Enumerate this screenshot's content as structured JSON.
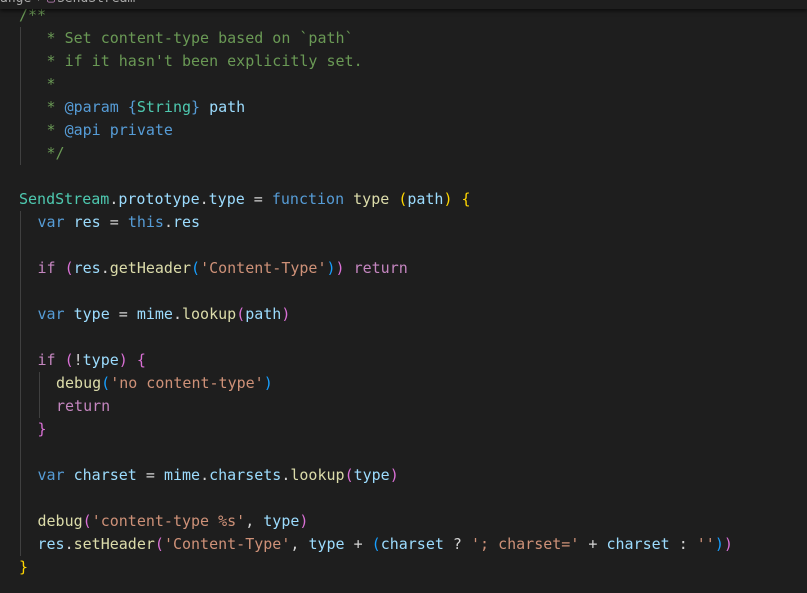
{
  "breadcrumb": {
    "segment1": "ange",
    "separator": "›",
    "symbol_icon": "method-icon",
    "segment2": "SendStream"
  },
  "colors": {
    "background": "#1e1e1e",
    "comment": "#6a9955",
    "keyword": "#569cd6",
    "control": "#c586c0",
    "variable": "#9cdcfe",
    "function": "#dcdcaa",
    "string": "#ce9178",
    "type": "#4ec9b0",
    "bracket_level1": "#ffd700",
    "bracket_level2": "#da70d6",
    "bracket_level3": "#179fff"
  },
  "code": [
    {
      "indent": 0,
      "tokens": [
        {
          "t": "/**",
          "c": "comment"
        }
      ]
    },
    {
      "indent": 1,
      "tokens": [
        {
          "t": " * Set content-type based on `path`",
          "c": "comment"
        }
      ]
    },
    {
      "indent": 1,
      "tokens": [
        {
          "t": " * if it hasn't been explicitly set.",
          "c": "comment"
        }
      ]
    },
    {
      "indent": 1,
      "tokens": [
        {
          "t": " *",
          "c": "comment"
        }
      ]
    },
    {
      "indent": 1,
      "tokens": [
        {
          "t": " * ",
          "c": "comment"
        },
        {
          "t": "@param",
          "c": "tag"
        },
        {
          "t": " ",
          "c": "comment"
        },
        {
          "t": "{",
          "c": "tag"
        },
        {
          "t": "String",
          "c": "type"
        },
        {
          "t": "}",
          "c": "tag"
        },
        {
          "t": " ",
          "c": "comment"
        },
        {
          "t": "path",
          "c": "var"
        }
      ]
    },
    {
      "indent": 1,
      "tokens": [
        {
          "t": " * ",
          "c": "comment"
        },
        {
          "t": "@api",
          "c": "tag"
        },
        {
          "t": " ",
          "c": "comment"
        },
        {
          "t": "private",
          "c": "tag"
        }
      ]
    },
    {
      "indent": 1,
      "tokens": [
        {
          "t": " */",
          "c": "comment"
        }
      ]
    },
    {
      "indent": 0,
      "tokens": []
    },
    {
      "indent": 0,
      "tokens": [
        {
          "t": "SendStream",
          "c": "type"
        },
        {
          "t": ".",
          "c": "op"
        },
        {
          "t": "prototype",
          "c": "var"
        },
        {
          "t": ".",
          "c": "op"
        },
        {
          "t": "type",
          "c": "var"
        },
        {
          "t": " = ",
          "c": "op"
        },
        {
          "t": "function",
          "c": "kw"
        },
        {
          "t": " ",
          "c": "op"
        },
        {
          "t": "type",
          "c": "fn"
        },
        {
          "t": " ",
          "c": "op"
        },
        {
          "t": "(",
          "c": "b1"
        },
        {
          "t": "path",
          "c": "var"
        },
        {
          "t": ")",
          "c": "b1"
        },
        {
          "t": " ",
          "c": "op"
        },
        {
          "t": "{",
          "c": "b1"
        }
      ]
    },
    {
      "indent": 1,
      "tokens": [
        {
          "t": "var",
          "c": "kw"
        },
        {
          "t": " ",
          "c": "op"
        },
        {
          "t": "res",
          "c": "var"
        },
        {
          "t": " = ",
          "c": "op"
        },
        {
          "t": "this",
          "c": "kw"
        },
        {
          "t": ".",
          "c": "op"
        },
        {
          "t": "res",
          "c": "var"
        }
      ]
    },
    {
      "indent": 1,
      "tokens": []
    },
    {
      "indent": 1,
      "tokens": [
        {
          "t": "if",
          "c": "ctrl"
        },
        {
          "t": " ",
          "c": "op"
        },
        {
          "t": "(",
          "c": "b2"
        },
        {
          "t": "res",
          "c": "var"
        },
        {
          "t": ".",
          "c": "op"
        },
        {
          "t": "getHeader",
          "c": "fn"
        },
        {
          "t": "(",
          "c": "b3"
        },
        {
          "t": "'Content-Type'",
          "c": "str"
        },
        {
          "t": ")",
          "c": "b3"
        },
        {
          "t": ")",
          "c": "b2"
        },
        {
          "t": " ",
          "c": "op"
        },
        {
          "t": "return",
          "c": "ctrl"
        }
      ]
    },
    {
      "indent": 1,
      "tokens": []
    },
    {
      "indent": 1,
      "tokens": [
        {
          "t": "var",
          "c": "kw"
        },
        {
          "t": " ",
          "c": "op"
        },
        {
          "t": "type",
          "c": "var"
        },
        {
          "t": " = ",
          "c": "op"
        },
        {
          "t": "mime",
          "c": "var"
        },
        {
          "t": ".",
          "c": "op"
        },
        {
          "t": "lookup",
          "c": "fn"
        },
        {
          "t": "(",
          "c": "b2"
        },
        {
          "t": "path",
          "c": "var"
        },
        {
          "t": ")",
          "c": "b2"
        }
      ]
    },
    {
      "indent": 1,
      "tokens": []
    },
    {
      "indent": 1,
      "tokens": [
        {
          "t": "if",
          "c": "ctrl"
        },
        {
          "t": " ",
          "c": "op"
        },
        {
          "t": "(",
          "c": "b2"
        },
        {
          "t": "!",
          "c": "op"
        },
        {
          "t": "type",
          "c": "var"
        },
        {
          "t": ")",
          "c": "b2"
        },
        {
          "t": " ",
          "c": "op"
        },
        {
          "t": "{",
          "c": "b2"
        }
      ]
    },
    {
      "indent": 2,
      "tokens": [
        {
          "t": "debug",
          "c": "fn"
        },
        {
          "t": "(",
          "c": "b3"
        },
        {
          "t": "'no content-type'",
          "c": "str"
        },
        {
          "t": ")",
          "c": "b3"
        }
      ]
    },
    {
      "indent": 2,
      "tokens": [
        {
          "t": "return",
          "c": "ctrl"
        }
      ]
    },
    {
      "indent": 1,
      "tokens": [
        {
          "t": "}",
          "c": "b2"
        }
      ]
    },
    {
      "indent": 1,
      "tokens": []
    },
    {
      "indent": 1,
      "tokens": [
        {
          "t": "var",
          "c": "kw"
        },
        {
          "t": " ",
          "c": "op"
        },
        {
          "t": "charset",
          "c": "var"
        },
        {
          "t": " = ",
          "c": "op"
        },
        {
          "t": "mime",
          "c": "var"
        },
        {
          "t": ".",
          "c": "op"
        },
        {
          "t": "charsets",
          "c": "var"
        },
        {
          "t": ".",
          "c": "op"
        },
        {
          "t": "lookup",
          "c": "fn"
        },
        {
          "t": "(",
          "c": "b2"
        },
        {
          "t": "type",
          "c": "var"
        },
        {
          "t": ")",
          "c": "b2"
        }
      ]
    },
    {
      "indent": 1,
      "tokens": []
    },
    {
      "indent": 1,
      "tokens": [
        {
          "t": "debug",
          "c": "fn"
        },
        {
          "t": "(",
          "c": "b2"
        },
        {
          "t": "'content-type %s'",
          "c": "str"
        },
        {
          "t": ", ",
          "c": "op"
        },
        {
          "t": "type",
          "c": "var"
        },
        {
          "t": ")",
          "c": "b2"
        }
      ]
    },
    {
      "indent": 1,
      "tokens": [
        {
          "t": "res",
          "c": "var"
        },
        {
          "t": ".",
          "c": "op"
        },
        {
          "t": "setHeader",
          "c": "fn"
        },
        {
          "t": "(",
          "c": "b2"
        },
        {
          "t": "'Content-Type'",
          "c": "str"
        },
        {
          "t": ", ",
          "c": "op"
        },
        {
          "t": "type",
          "c": "var"
        },
        {
          "t": " + ",
          "c": "op"
        },
        {
          "t": "(",
          "c": "b3"
        },
        {
          "t": "charset",
          "c": "var"
        },
        {
          "t": " ? ",
          "c": "op"
        },
        {
          "t": "'; charset='",
          "c": "str"
        },
        {
          "t": " + ",
          "c": "op"
        },
        {
          "t": "charset",
          "c": "var"
        },
        {
          "t": " : ",
          "c": "op"
        },
        {
          "t": "''",
          "c": "str"
        },
        {
          "t": ")",
          "c": "b3"
        },
        {
          "t": ")",
          "c": "b2"
        }
      ]
    },
    {
      "indent": 0,
      "tokens": [
        {
          "t": "}",
          "c": "b1"
        }
      ]
    }
  ]
}
